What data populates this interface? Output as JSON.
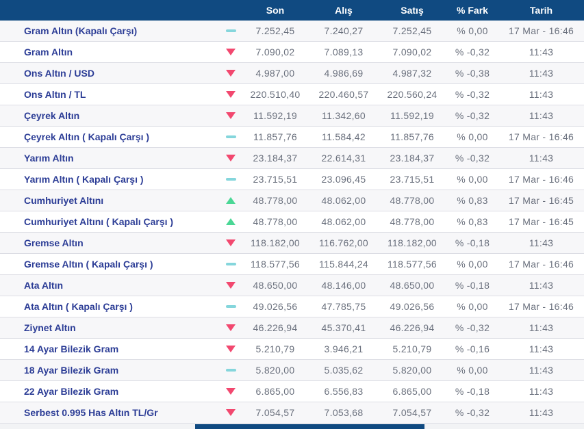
{
  "table": {
    "columns": {
      "son": "Son",
      "alis": "Alış",
      "satis": "Satış",
      "fark": "% Fark",
      "tarih": "Tarih"
    },
    "colors": {
      "header_bg": "#104a81",
      "name_text": "#2c3d96",
      "value_text": "#6a707d",
      "row_alt_bg": "#f7f7f9",
      "trend_down": "#f2486f",
      "trend_up": "#4ad795",
      "trend_flat": "#85d6dc",
      "scrollbar_thumb": "#104a81"
    },
    "rows": [
      {
        "name": "Gram Altın (Kapalı Çarşı)",
        "trend": "flat",
        "son": "7.252,45",
        "alis": "7.240,27",
        "satis": "7.252,45",
        "fark": "% 0,00",
        "tarih": "17 Mar - 16:46"
      },
      {
        "name": "Gram Altın",
        "trend": "down",
        "son": "7.090,02",
        "alis": "7.089,13",
        "satis": "7.090,02",
        "fark": "% -0,32",
        "tarih": "11:43"
      },
      {
        "name": "Ons Altın / USD",
        "trend": "down",
        "son": "4.987,00",
        "alis": "4.986,69",
        "satis": "4.987,32",
        "fark": "% -0,38",
        "tarih": "11:43"
      },
      {
        "name": "Ons Altın / TL",
        "trend": "down",
        "son": "220.510,40",
        "alis": "220.460,57",
        "satis": "220.560,24",
        "fark": "% -0,32",
        "tarih": "11:43"
      },
      {
        "name": "Çeyrek Altın",
        "trend": "down",
        "son": "11.592,19",
        "alis": "11.342,60",
        "satis": "11.592,19",
        "fark": "% -0,32",
        "tarih": "11:43"
      },
      {
        "name": "Çeyrek Altın ( Kapalı Çarşı )",
        "trend": "flat",
        "son": "11.857,76",
        "alis": "11.584,42",
        "satis": "11.857,76",
        "fark": "% 0,00",
        "tarih": "17 Mar - 16:46"
      },
      {
        "name": "Yarım Altın",
        "trend": "down",
        "son": "23.184,37",
        "alis": "22.614,31",
        "satis": "23.184,37",
        "fark": "% -0,32",
        "tarih": "11:43"
      },
      {
        "name": "Yarım Altın ( Kapalı Çarşı )",
        "trend": "flat",
        "son": "23.715,51",
        "alis": "23.096,45",
        "satis": "23.715,51",
        "fark": "% 0,00",
        "tarih": "17 Mar - 16:46"
      },
      {
        "name": "Cumhuriyet Altını",
        "trend": "up",
        "son": "48.778,00",
        "alis": "48.062,00",
        "satis": "48.778,00",
        "fark": "% 0,83",
        "tarih": "17 Mar - 16:45"
      },
      {
        "name": "Cumhuriyet Altını ( Kapalı Çarşı )",
        "trend": "up",
        "son": "48.778,00",
        "alis": "48.062,00",
        "satis": "48.778,00",
        "fark": "% 0,83",
        "tarih": "17 Mar - 16:45"
      },
      {
        "name": "Gremse Altın",
        "trend": "down",
        "son": "118.182,00",
        "alis": "116.762,00",
        "satis": "118.182,00",
        "fark": "% -0,18",
        "tarih": "11:43"
      },
      {
        "name": "Gremse Altın ( Kapalı Çarşı )",
        "trend": "flat",
        "son": "118.577,56",
        "alis": "115.844,24",
        "satis": "118.577,56",
        "fark": "% 0,00",
        "tarih": "17 Mar - 16:46"
      },
      {
        "name": "Ata Altın",
        "trend": "down",
        "son": "48.650,00",
        "alis": "48.146,00",
        "satis": "48.650,00",
        "fark": "% -0,18",
        "tarih": "11:43"
      },
      {
        "name": "Ata Altın ( Kapalı Çarşı )",
        "trend": "flat",
        "son": "49.026,56",
        "alis": "47.785,75",
        "satis": "49.026,56",
        "fark": "% 0,00",
        "tarih": "17 Mar - 16:46"
      },
      {
        "name": "Ziynet Altın",
        "trend": "down",
        "son": "46.226,94",
        "alis": "45.370,41",
        "satis": "46.226,94",
        "fark": "% -0,32",
        "tarih": "11:43"
      },
      {
        "name": "14 Ayar Bilezik Gram",
        "trend": "down",
        "son": "5.210,79",
        "alis": "3.946,21",
        "satis": "5.210,79",
        "fark": "% -0,16",
        "tarih": "11:43"
      },
      {
        "name": "18 Ayar Bilezik Gram",
        "trend": "flat",
        "son": "5.820,00",
        "alis": "5.035,62",
        "satis": "5.820,00",
        "fark": "% 0,00",
        "tarih": "11:43"
      },
      {
        "name": "22 Ayar Bilezik Gram",
        "trend": "down",
        "son": "6.865,00",
        "alis": "6.556,83",
        "satis": "6.865,00",
        "fark": "% -0,18",
        "tarih": "11:43"
      },
      {
        "name": "Serbest 0.995 Has Altın TL/Gr",
        "trend": "down",
        "son": "7.054,57",
        "alis": "7.053,68",
        "satis": "7.054,57",
        "fark": "% -0,32",
        "tarih": "11:43"
      }
    ]
  }
}
